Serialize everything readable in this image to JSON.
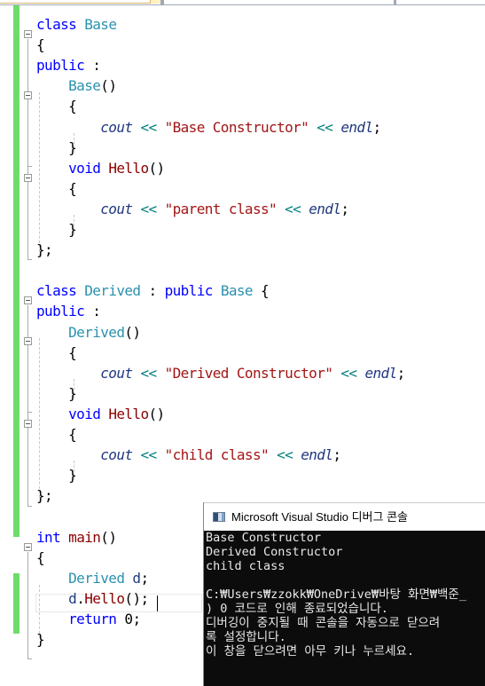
{
  "editor": {
    "lines": [
      {
        "tokens": [
          {
            "t": "class",
            "c": "kw"
          },
          {
            "t": " "
          },
          {
            "t": "Base",
            "c": "type"
          }
        ]
      },
      {
        "tokens": [
          {
            "t": "{",
            "c": "punc"
          }
        ]
      },
      {
        "tokens": [
          {
            "t": "public",
            "c": "kw"
          },
          {
            "t": " :",
            "c": "punc"
          }
        ]
      },
      {
        "tokens": [
          {
            "t": "    "
          },
          {
            "t": "Base",
            "c": "type"
          },
          {
            "t": "()",
            "c": "punc"
          }
        ]
      },
      {
        "tokens": [
          {
            "t": "    {",
            "c": "punc"
          }
        ]
      },
      {
        "tokens": [
          {
            "t": "        "
          },
          {
            "t": "cout",
            "c": "var"
          },
          {
            "t": " "
          },
          {
            "t": "<<",
            "c": "op"
          },
          {
            "t": " "
          },
          {
            "t": "\"Base Constructor\"",
            "c": "str"
          },
          {
            "t": " "
          },
          {
            "t": "<<",
            "c": "op"
          },
          {
            "t": " "
          },
          {
            "t": "endl",
            "c": "var"
          },
          {
            "t": ";",
            "c": "punc"
          }
        ]
      },
      {
        "tokens": [
          {
            "t": "    }",
            "c": "punc"
          }
        ]
      },
      {
        "tokens": [
          {
            "t": "    "
          },
          {
            "t": "void",
            "c": "kw"
          },
          {
            "t": " "
          },
          {
            "t": "Hello",
            "c": "fnr"
          },
          {
            "t": "()",
            "c": "punc"
          }
        ]
      },
      {
        "tokens": [
          {
            "t": "    {",
            "c": "punc"
          }
        ]
      },
      {
        "tokens": [
          {
            "t": "        "
          },
          {
            "t": "cout",
            "c": "var"
          },
          {
            "t": " "
          },
          {
            "t": "<<",
            "c": "op"
          },
          {
            "t": " "
          },
          {
            "t": "\"parent class\"",
            "c": "str"
          },
          {
            "t": " "
          },
          {
            "t": "<<",
            "c": "op"
          },
          {
            "t": " "
          },
          {
            "t": "endl",
            "c": "var"
          },
          {
            "t": ";",
            "c": "punc"
          }
        ]
      },
      {
        "tokens": [
          {
            "t": "    }",
            "c": "punc"
          }
        ]
      },
      {
        "tokens": [
          {
            "t": "};",
            "c": "punc"
          }
        ]
      },
      {
        "tokens": []
      },
      {
        "tokens": [
          {
            "t": "class",
            "c": "kw"
          },
          {
            "t": " "
          },
          {
            "t": "Derived",
            "c": "type"
          },
          {
            "t": " : ",
            "c": "punc"
          },
          {
            "t": "public",
            "c": "kw"
          },
          {
            "t": " "
          },
          {
            "t": "Base",
            "c": "type"
          },
          {
            "t": " {",
            "c": "punc"
          }
        ]
      },
      {
        "tokens": [
          {
            "t": "public",
            "c": "kw"
          },
          {
            "t": " :",
            "c": "punc"
          }
        ]
      },
      {
        "tokens": [
          {
            "t": "    "
          },
          {
            "t": "Derived",
            "c": "type"
          },
          {
            "t": "()",
            "c": "punc"
          }
        ]
      },
      {
        "tokens": [
          {
            "t": "    {",
            "c": "punc"
          }
        ]
      },
      {
        "tokens": [
          {
            "t": "        "
          },
          {
            "t": "cout",
            "c": "var"
          },
          {
            "t": " "
          },
          {
            "t": "<<",
            "c": "op"
          },
          {
            "t": " "
          },
          {
            "t": "\"Derived Constructor\"",
            "c": "str"
          },
          {
            "t": " "
          },
          {
            "t": "<<",
            "c": "op"
          },
          {
            "t": " "
          },
          {
            "t": "endl",
            "c": "var"
          },
          {
            "t": ";",
            "c": "punc"
          }
        ]
      },
      {
        "tokens": [
          {
            "t": "    }",
            "c": "punc"
          }
        ]
      },
      {
        "tokens": [
          {
            "t": "    "
          },
          {
            "t": "void",
            "c": "kw"
          },
          {
            "t": " "
          },
          {
            "t": "Hello",
            "c": "fnr"
          },
          {
            "t": "()",
            "c": "punc"
          }
        ]
      },
      {
        "tokens": [
          {
            "t": "    {",
            "c": "punc"
          }
        ]
      },
      {
        "tokens": [
          {
            "t": "        "
          },
          {
            "t": "cout",
            "c": "var"
          },
          {
            "t": " "
          },
          {
            "t": "<<",
            "c": "op"
          },
          {
            "t": " "
          },
          {
            "t": "\"child class\"",
            "c": "str"
          },
          {
            "t": " "
          },
          {
            "t": "<<",
            "c": "op"
          },
          {
            "t": " "
          },
          {
            "t": "endl",
            "c": "var"
          },
          {
            "t": ";",
            "c": "punc"
          }
        ]
      },
      {
        "tokens": [
          {
            "t": "    }",
            "c": "punc"
          }
        ]
      },
      {
        "tokens": [
          {
            "t": "};",
            "c": "punc"
          }
        ]
      },
      {
        "tokens": []
      },
      {
        "tokens": [
          {
            "t": "int",
            "c": "kw"
          },
          {
            "t": " "
          },
          {
            "t": "main",
            "c": "fnr"
          },
          {
            "t": "()",
            "c": "punc"
          }
        ]
      },
      {
        "tokens": [
          {
            "t": "{",
            "c": "punc"
          }
        ]
      },
      {
        "tokens": [
          {
            "t": "    "
          },
          {
            "t": "Derived",
            "c": "type"
          },
          {
            "t": " "
          },
          {
            "t": "d",
            "c": "local"
          },
          {
            "t": ";",
            "c": "punc"
          }
        ]
      },
      {
        "tokens": [
          {
            "t": "    "
          },
          {
            "t": "d",
            "c": "local"
          },
          {
            "t": ".",
            "c": "punc"
          },
          {
            "t": "Hello",
            "c": "fnr"
          },
          {
            "t": "();",
            "c": "punc"
          }
        ]
      },
      {
        "tokens": [
          {
            "t": "    "
          },
          {
            "t": "return",
            "c": "kw"
          },
          {
            "t": " "
          },
          {
            "t": "0",
            "c": "num"
          },
          {
            "t": ";",
            "c": "punc"
          }
        ]
      },
      {
        "tokens": [
          {
            "t": "}",
            "c": "punc"
          }
        ]
      }
    ]
  },
  "console": {
    "title": "Microsoft Visual Studio 디버그 콘솔",
    "icon": "console-window-icon",
    "lines": [
      "Base Constructor",
      "Derived Constructor",
      "child class",
      "",
      "C:₩Users₩zzokk₩OneDrive₩바탕 화면₩백준_",
      ") 0 코드로 인해 종료되었습니다.",
      "디버깅이 중지될 때 콘솔을 자동으로 닫으려",
      "록 설정합니다.",
      "이 창을 닫으려면 아무 키나 누르세요."
    ]
  },
  "colors": {
    "keyword": "#0000ff",
    "type": "#2b91af",
    "string": "#a31515",
    "operator": "#008080",
    "change_marker": "#6fdc6a",
    "console_bg": "#0c0c0c"
  }
}
